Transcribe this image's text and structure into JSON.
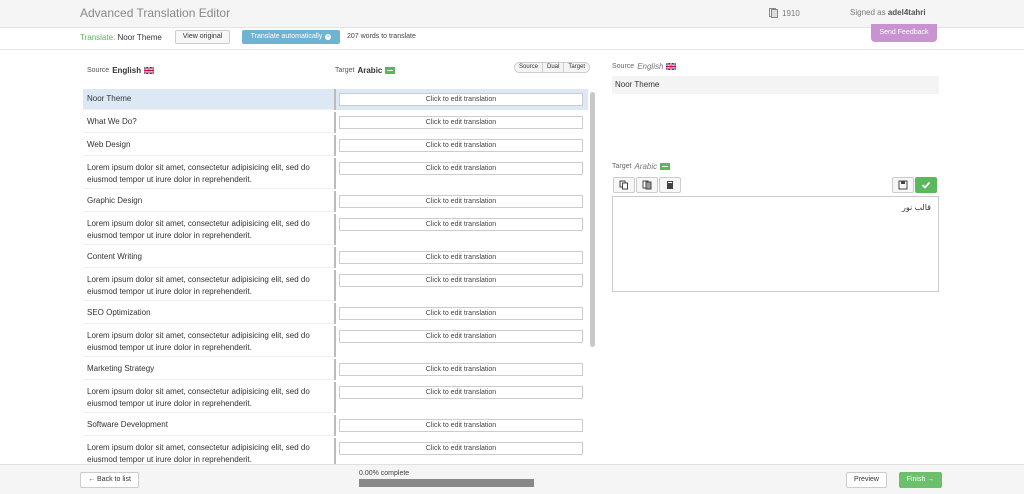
{
  "header": {
    "title": "Advanced Translation Editor",
    "credits": "1910",
    "signed_prefix": "Signed as",
    "username": "adel4tahri",
    "feedback_label": "Send Feedback"
  },
  "toolbar": {
    "translate_label": "Translate:",
    "project_name": "Noor Theme",
    "view_original_label": "View original",
    "auto_translate_label": "Translate automatically",
    "words_count": "207 words to translate"
  },
  "columns": {
    "source_prefix": "Source",
    "source_lang": "English",
    "target_prefix": "Target",
    "target_lang": "Arabic",
    "view_modes": [
      "Source",
      "Dual",
      "Target"
    ]
  },
  "rows": [
    {
      "source": "Noor Theme",
      "target": "Click to edit translation"
    },
    {
      "source": "What We Do?",
      "target": "Click to edit translation"
    },
    {
      "source": "Web Design",
      "target": "Click to edit translation"
    },
    {
      "source": "Lorem ipsum dolor sit amet, consectetur adipisicing elit, sed do eiusmod tempor ut irure dolor in reprehenderit.",
      "target": "Click to edit translation"
    },
    {
      "source": "Graphic Design",
      "target": "Click to edit translation"
    },
    {
      "source": "Lorem ipsum dolor sit amet, consectetur adipisicing elit, sed do eiusmod tempor ut irure dolor in reprehenderit.",
      "target": "Click to edit translation"
    },
    {
      "source": "Content Writing",
      "target": "Click to edit translation"
    },
    {
      "source": "Lorem ipsum dolor sit amet, consectetur adipisicing elit, sed do eiusmod tempor ut irure dolor in reprehenderit.",
      "target": "Click to edit translation"
    },
    {
      "source": "SEO Optimization",
      "target": "Click to edit translation"
    },
    {
      "source": "Lorem ipsum dolor sit amet, consectetur adipisicing elit, sed do eiusmod tempor ut irure dolor in reprehenderit.",
      "target": "Click to edit translation"
    },
    {
      "source": "Marketing Strategy",
      "target": "Click to edit translation"
    },
    {
      "source": "Lorem ipsum dolor sit amet, consectetur adipisicing elit, sed do eiusmod tempor ut irure dolor in reprehenderit.",
      "target": "Click to edit translation"
    },
    {
      "source": "Software Development",
      "target": "Click to edit translation"
    },
    {
      "source": "Lorem ipsum dolor sit amet, consectetur adipisicing elit, sed do eiusmod tempor ut irure dolor in reprehenderit.",
      "target": "Click to edit translation"
    }
  ],
  "detail": {
    "source_prefix": "Source",
    "source_lang": "English",
    "source_text": "Noor Theme",
    "target_prefix": "Target",
    "target_lang": "Arabic",
    "target_text": "قالب نور"
  },
  "footer": {
    "back_label": "← Back to list",
    "progress_label": "0.00% complete",
    "progress_percent": 0,
    "preview_label": "Preview",
    "finish_label": "Finish →"
  },
  "colors": {
    "accent_green": "#5bb75b",
    "accent_blue": "#6fb3d2",
    "feedback_purple": "#c993d1"
  }
}
